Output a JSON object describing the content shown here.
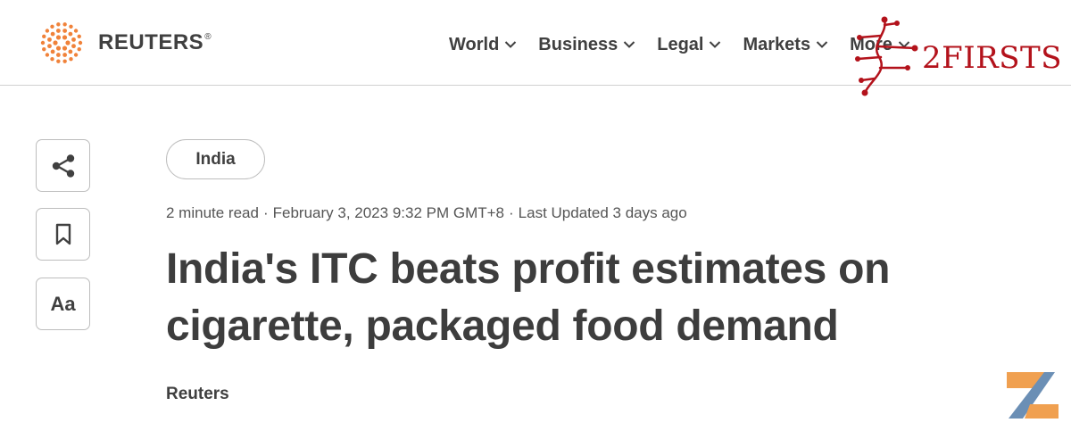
{
  "brand": {
    "name": "REUTERS",
    "registered": "®",
    "accent_color": "#f0823a"
  },
  "nav": {
    "items": [
      {
        "label": "World",
        "icon": "chevron-down-icon"
      },
      {
        "label": "Business",
        "icon": "chevron-down-icon"
      },
      {
        "label": "Legal",
        "icon": "chevron-down-icon"
      },
      {
        "label": "Markets",
        "icon": "chevron-down-icon"
      },
      {
        "label": "More",
        "icon": "chevron-down-icon"
      }
    ]
  },
  "watermark": {
    "text": "2FIRSTS",
    "color": "#b3121b"
  },
  "rail": {
    "share_icon": "share-icon",
    "bookmark_icon": "bookmark-icon",
    "text_size_label": "Aa"
  },
  "article": {
    "tag": "India",
    "read_time": "2 minute read",
    "published": "February 3, 2023 9:32 PM GMT+8",
    "updated": "Last Updated 3 days ago",
    "separator": "·",
    "headline": "India's ITC beats profit estimates on cigarette, packaged food demand",
    "byline": "Reuters"
  },
  "corner_logo": {
    "icon": "z-logo-icon",
    "colors": [
      "#f0a050",
      "#6b8fb5"
    ]
  }
}
